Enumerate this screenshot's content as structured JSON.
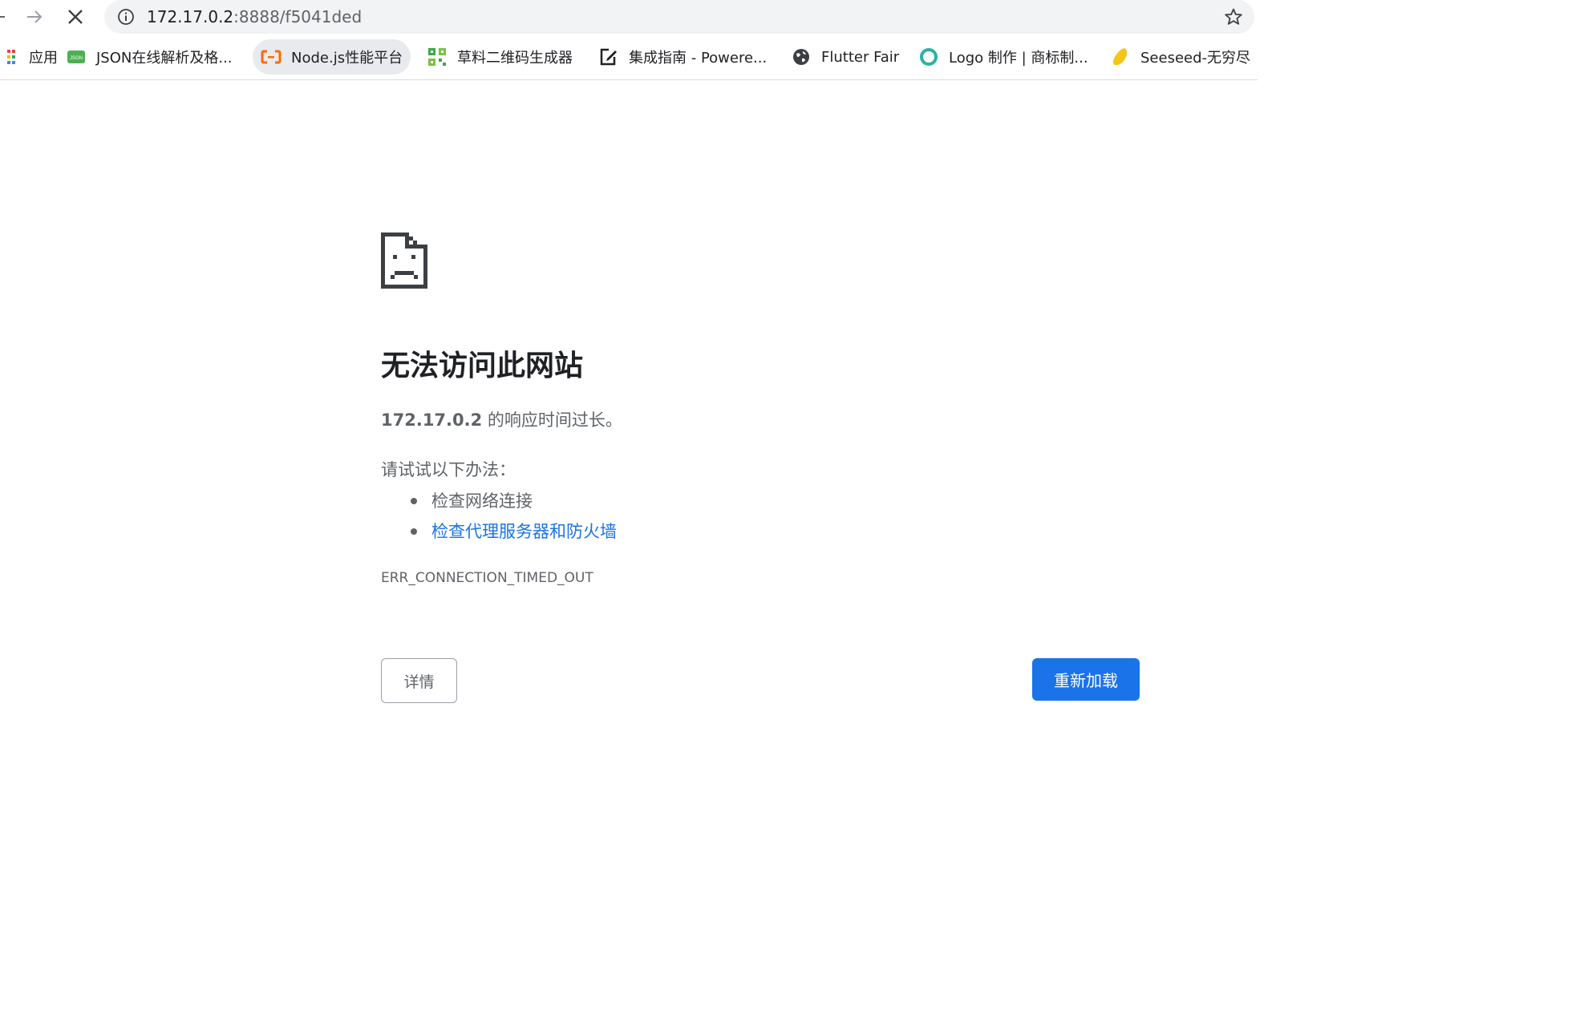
{
  "toolbar": {
    "back_icon": "back-arrow-icon",
    "forward_icon": "forward-arrow-icon",
    "stop_icon": "close-icon",
    "url_host": "172.17.0.2",
    "url_rest": ":8888/f5041ded",
    "info_icon": "info-icon",
    "bookmark_star_icon": "star-icon"
  },
  "bookmarks": [
    {
      "label": "应用",
      "icon": "apps-grid-icon"
    },
    {
      "label": "JSON在线解析及格...",
      "icon": "json-icon"
    },
    {
      "label": "Node.js性能平台",
      "icon": "alibaba-cloud-icon"
    },
    {
      "label": "草料二维码生成器",
      "icon": "qr-code-icon"
    },
    {
      "label": "集成指南 - Powere...",
      "icon": "edit-note-icon"
    },
    {
      "label": "Flutter Fair",
      "icon": "globe-icon"
    },
    {
      "label": "Logo 制作 | 商标制...",
      "icon": "logo-ring-icon"
    },
    {
      "label": "Seeseed-无穷尽",
      "icon": "seed-icon"
    }
  ],
  "error": {
    "icon": "sad-page-icon",
    "title": "无法访问此网站",
    "host": "172.17.0.2",
    "summary_suffix": " 的响应时间过长。",
    "suggestions_heading": "请试试以下办法：",
    "suggestions": [
      "检查网络连接",
      "检查代理服务器和防火墙"
    ],
    "code": "ERR_CONNECTION_TIMED_OUT",
    "details_label": "详情",
    "reload_label": "重新加载"
  },
  "colors": {
    "accent": "#1a73e8",
    "text_primary": "#202124",
    "text_secondary": "#5f6368",
    "omnibox_bg": "#f1f3f4"
  }
}
